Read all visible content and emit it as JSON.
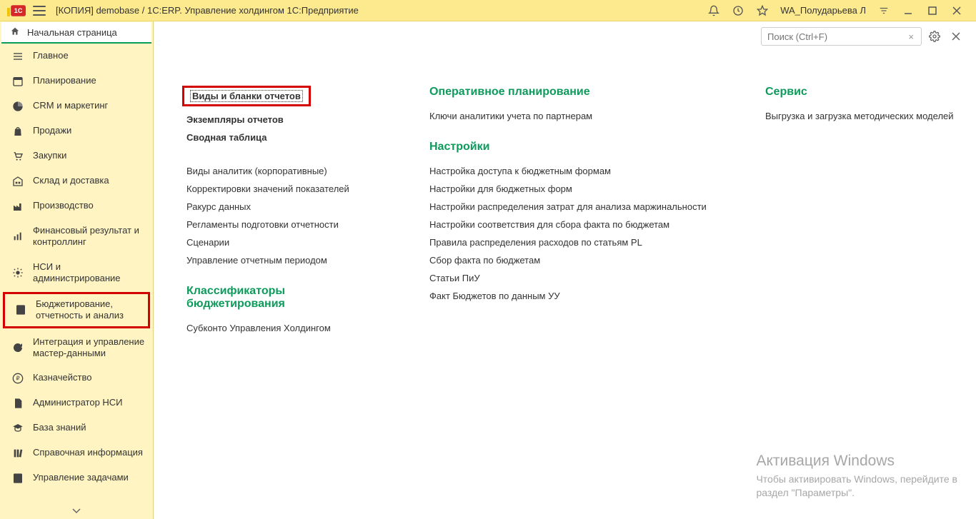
{
  "titlebar": {
    "title": "[КОПИЯ] demobase / 1С:ERP. Управление холдингом 1С:Предприятие",
    "username": "WA_Полударьева Л"
  },
  "home": {
    "label": "Начальная страница"
  },
  "sidebar": {
    "items": [
      {
        "label": "Главное",
        "icon": "menu"
      },
      {
        "label": "Планирование",
        "icon": "calendar"
      },
      {
        "label": "CRM и маркетинг",
        "icon": "pie"
      },
      {
        "label": "Продажи",
        "icon": "bag"
      },
      {
        "label": "Закупки",
        "icon": "cart"
      },
      {
        "label": "Склад и доставка",
        "icon": "warehouse"
      },
      {
        "label": "Производство",
        "icon": "industry"
      },
      {
        "label": "Финансовый результат и контроллинг",
        "icon": "bars"
      },
      {
        "label": "НСИ и администрирование",
        "icon": "gear"
      },
      {
        "label": "Бюджетирование, отчетность и анализ",
        "icon": "report",
        "highlighted": true
      },
      {
        "label": "Интеграция и управление мастер-данными",
        "icon": "cycle"
      },
      {
        "label": "Казначейство",
        "icon": "ruble"
      },
      {
        "label": "Администратор НСИ",
        "icon": "doc"
      },
      {
        "label": "База знаний",
        "icon": "grad"
      },
      {
        "label": "Справочная информация",
        "icon": "books"
      },
      {
        "label": "Управление задачами",
        "icon": "task"
      }
    ]
  },
  "toolbar": {
    "search_placeholder": "Поиск (Ctrl+F)"
  },
  "content": {
    "column1": {
      "highlighted": "Виды и бланки отчетов",
      "bold_links": [
        "Экземпляры отчетов",
        "Сводная таблица"
      ],
      "links1": [
        "Виды аналитик (корпоративные)",
        "Корректировки значений показателей",
        "Ракурс данных",
        "Регламенты подготовки отчетности",
        "Сценарии",
        "Управление отчетным периодом"
      ],
      "section2_title": "Классификаторы бюджетирования",
      "links2": [
        "Субконто Управления Холдингом"
      ]
    },
    "column2": {
      "section1_title": "Оперативное планирование",
      "links1": [
        "Ключи аналитики учета по партнерам"
      ],
      "section2_title": "Настройки",
      "links2": [
        "Настройка доступа к бюджетным формам",
        "Настройки для бюджетных форм",
        "Настройки распределения затрат для анализа маржинальности",
        "Настройки соответствия для сбора факта по бюджетам",
        "Правила распределения расходов по статьям PL",
        "Сбор факта по бюджетам",
        "Статьи ПиУ",
        "Факт Бюджетов по данным УУ"
      ]
    },
    "column3": {
      "section1_title": "Сервис",
      "links1": [
        "Выгрузка и загрузка методических моделей"
      ]
    }
  },
  "watermark": {
    "title": "Активация Windows",
    "sub1": "Чтобы активировать Windows, перейдите в",
    "sub2": "раздел \"Параметры\"."
  }
}
